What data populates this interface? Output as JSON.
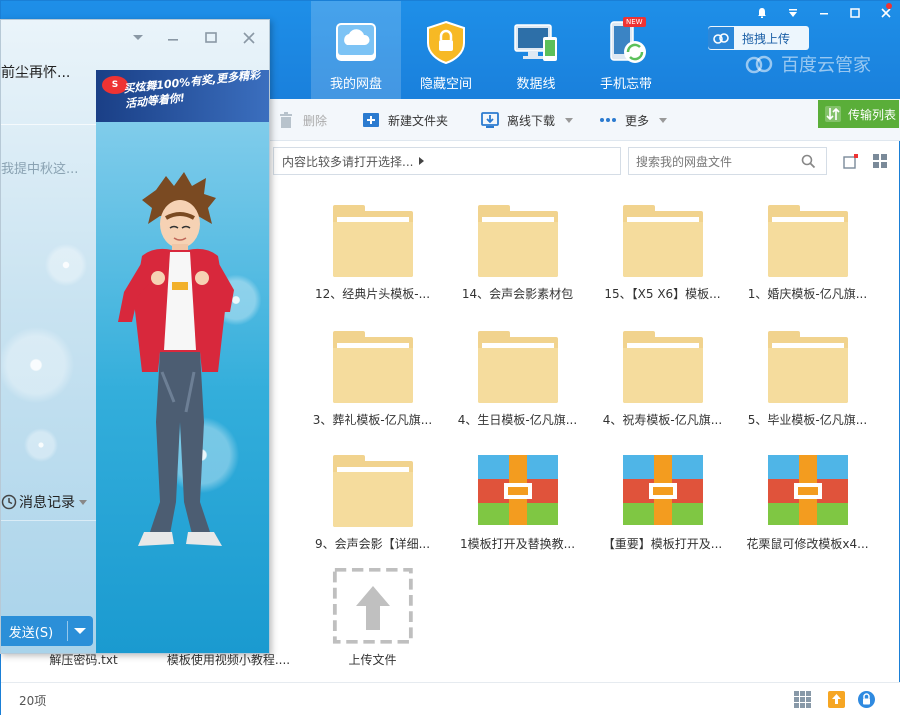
{
  "nav": {
    "items": [
      {
        "label": "我的网盘",
        "icon": "cloud-drive-icon",
        "active": true
      },
      {
        "label": "隐藏空间",
        "icon": "lock-shield-icon",
        "active": false
      },
      {
        "label": "数据线",
        "icon": "monitor-phone-icon",
        "active": false
      },
      {
        "label": "手机忘带",
        "icon": "phone-sync-icon",
        "active": false,
        "badge": "NEW"
      }
    ],
    "drag_upload": "拖拽上传",
    "brand": "百度云管家"
  },
  "toolbar": {
    "delete": "删除",
    "new_folder": "新建文件夹",
    "offline_download": "离线下载",
    "more": "更多",
    "transfer_list": "传输列表"
  },
  "address": {
    "breadcrumb": "内容比较多请打开选择...",
    "search_placeholder": "搜索我的网盘文件"
  },
  "files": [
    {
      "name": "12、经典片头模板-...",
      "type": "folder"
    },
    {
      "name": "14、会声会影素材包",
      "type": "folder"
    },
    {
      "name": "15、【X5 X6】模板...",
      "type": "folder"
    },
    {
      "name": "1、婚庆模板-亿凡旗...",
      "type": "folder"
    },
    {
      "name": "3、葬礼模板-亿凡旗...",
      "type": "folder"
    },
    {
      "name": "4、生日模板-亿凡旗...",
      "type": "folder"
    },
    {
      "name": "4、祝寿模板-亿凡旗...",
      "type": "folder"
    },
    {
      "name": "5、毕业模板-亿凡旗...",
      "type": "folder"
    },
    {
      "name": "9、会声会影【详细...",
      "type": "folder"
    },
    {
      "name": "1模板打开及替换教...",
      "type": "archive"
    },
    {
      "name": "【重要】模板打开及...",
      "type": "archive"
    },
    {
      "name": "花栗鼠可修改模板x4...",
      "type": "archive"
    },
    {
      "name": "上传文件",
      "type": "upload"
    }
  ],
  "bottom_row": {
    "file1": "解压密码.txt",
    "file2": "模板使用视频小教程...."
  },
  "status": {
    "count": "20项"
  },
  "chat": {
    "title": "前尘再怀...",
    "preview": "我提中秋这...",
    "message_record": "消息记录",
    "send": "发送(S)",
    "ad_text": "买炫舞100%有奖,更多精彩活动等着你!"
  },
  "colors": {
    "topbar": "#1e8fe8",
    "folder": "#f1d38e",
    "transfer": "#5aae39",
    "send_button": "#2b8fd8"
  }
}
